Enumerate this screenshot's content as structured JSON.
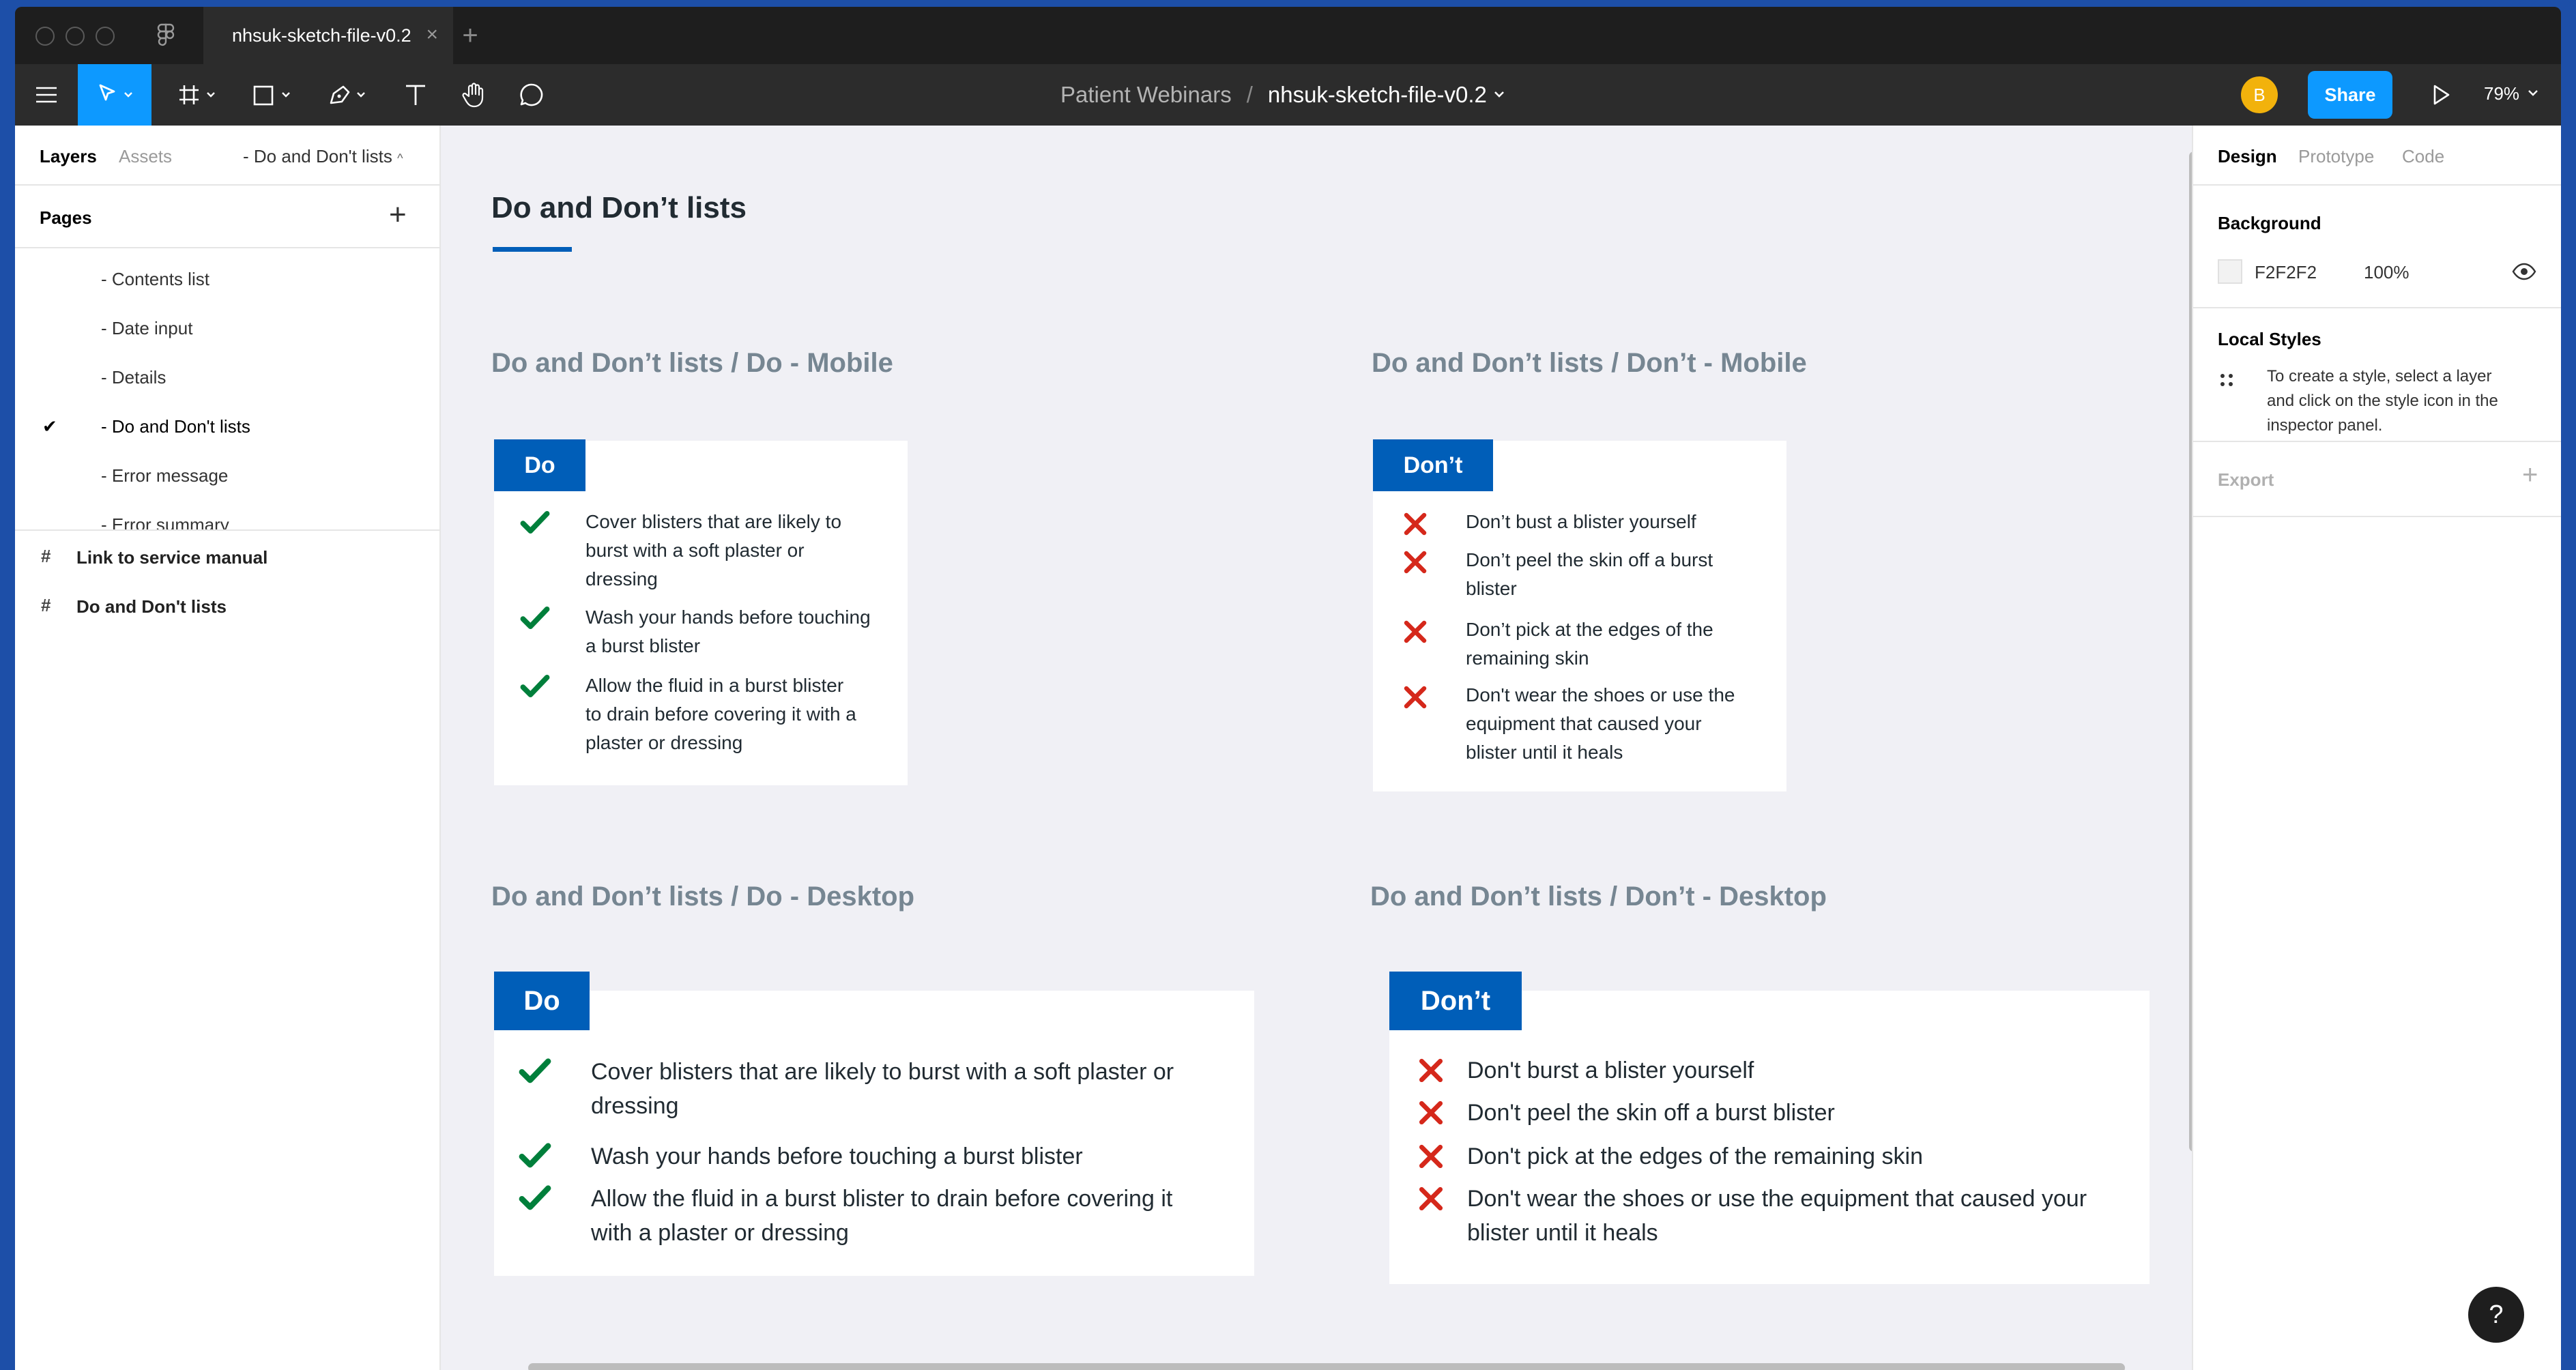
{
  "tab": {
    "title": "nhsuk-sketch-file-v0.2"
  },
  "breadcrumb": {
    "project": "Patient Webinars",
    "separator": "/",
    "file": "nhsuk-sketch-file-v0.2"
  },
  "header": {
    "avatar_initial": "B",
    "share_label": "Share",
    "zoom": "79%"
  },
  "left_panel": {
    "tabs": {
      "layers": "Layers",
      "assets": "Assets",
      "current_page": "Do and Don't lists"
    },
    "pages_title": "Pages",
    "pages": [
      "Contents list",
      "Date input",
      "Details",
      "Do and Don't lists",
      "Error message",
      "Error summary"
    ],
    "current_page_index": 3,
    "frames": [
      "Link to service manual",
      "Do and Don't lists"
    ]
  },
  "canvas": {
    "title": "Do and Don’t lists",
    "sections": {
      "do_mobile": "Do and Don’t lists / Do - Mobile",
      "dont_mobile": "Do and Don’t lists / Don’t - Mobile",
      "do_desktop": "Do and Don’t lists / Do - Desktop",
      "dont_desktop": "Do and Don’t lists / Don’t - Desktop"
    },
    "do_label": "Do",
    "dont_label": "Don’t",
    "do_mobile_items": [
      [
        "Cover blisters that are likely to",
        "burst with a soft plaster or",
        "dressing"
      ],
      [
        "Wash your hands before touching",
        "a burst blister"
      ],
      [
        "Allow the fluid in a burst blister",
        "to drain before covering it with a",
        "plaster or dressing"
      ]
    ],
    "dont_mobile_items": [
      [
        "Don’t bust a blister yourself"
      ],
      [
        "Don’t peel the skin off a burst",
        "blister"
      ],
      [
        "Don’t pick at the edges of the",
        "remaining skin"
      ],
      [
        "Don't wear the shoes or use the",
        "equipment that caused your",
        "blister until it heals"
      ]
    ],
    "do_desktop_items": [
      [
        "Cover blisters that are likely to burst with a soft plaster or",
        "dressing"
      ],
      [
        "Wash your hands before touching a burst blister"
      ],
      [
        "Allow the fluid in a burst blister to drain before covering it",
        "with a plaster or dressing"
      ]
    ],
    "dont_desktop_items": [
      [
        "Don't burst a blister yourself"
      ],
      [
        "Don't peel the skin off a burst blister"
      ],
      [
        "Don't pick at the edges of the remaining skin"
      ],
      [
        "Don't wear the shoes or use the equipment that caused your",
        "blister until it heals"
      ]
    ]
  },
  "right_panel": {
    "tabs": {
      "design": "Design",
      "prototype": "Prototype",
      "code": "Code"
    },
    "background_title": "Background",
    "bg_hex": "F2F2F2",
    "bg_opacity": "100%",
    "local_styles_title": "Local Styles",
    "local_styles_hint": [
      "To create a style, select a layer",
      "and click on the style icon in the",
      "inspector panel."
    ],
    "export_title": "Export"
  },
  "help_label": "?",
  "colors": {
    "nhs_blue": "#005eb8",
    "tick_green": "#007f3b",
    "cross_red": "#d5281b",
    "figma_blue": "#0d99ff"
  }
}
